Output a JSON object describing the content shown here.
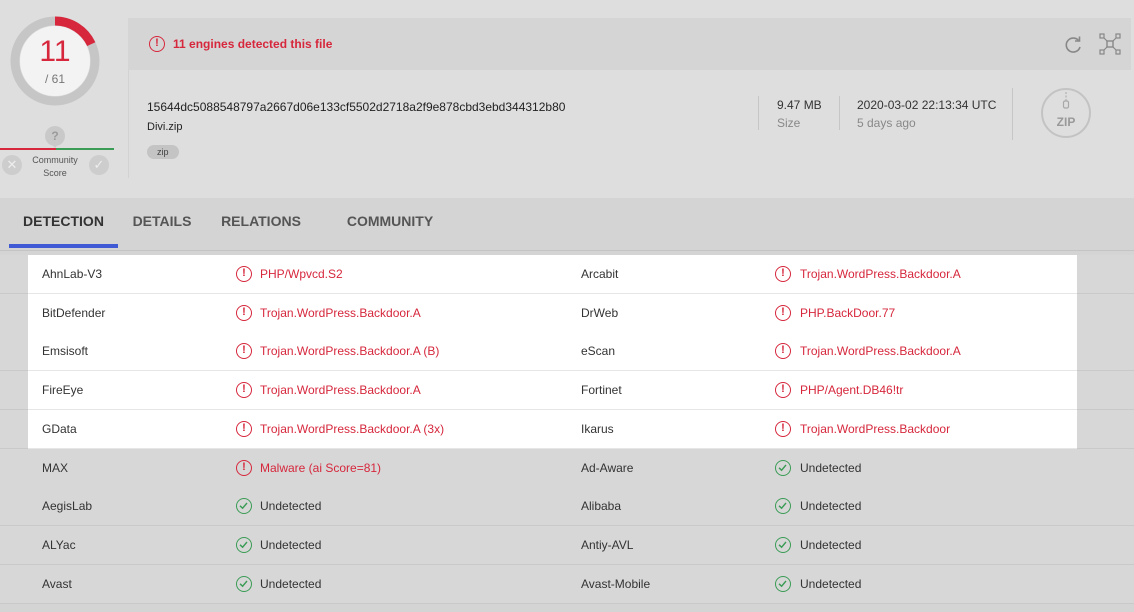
{
  "score": {
    "detected": "11",
    "total": "/ 61"
  },
  "community": {
    "label_line1": "Community",
    "label_line2": "Score",
    "question": "?",
    "neg": "✕",
    "pos": "✓"
  },
  "banner": {
    "text": "11 engines detected this file",
    "icon": "!"
  },
  "file": {
    "hash": "15644dc5088548797a2667d06e133cf5502d2718a2f9e878cbd3ebd344312b80",
    "name": "Divi.zip",
    "tag": "zip",
    "size_value": "9.47 MB",
    "size_label": "Size",
    "date_value": "2020-03-02 22:13:34 UTC",
    "date_label": "5 days ago",
    "type_icon_text": "ZIP"
  },
  "colors": {
    "danger": "#d6273c",
    "safe": "#3a9c55",
    "accent": "#3f5ad4"
  },
  "tabs": [
    {
      "label": "DETECTION",
      "active": true
    },
    {
      "label": "DETAILS",
      "active": false
    },
    {
      "label": "RELATIONS",
      "active": false
    },
    {
      "label": "COMMUNITY",
      "active": false
    }
  ],
  "results": [
    {
      "left": {
        "engine": "AhnLab-V3",
        "result": "PHP/Wpvcd.S2",
        "status": "detected"
      },
      "right": {
        "engine": "Arcabit",
        "result": "Trojan.WordPress.Backdoor.A",
        "status": "detected"
      }
    },
    {
      "left": {
        "engine": "BitDefender",
        "result": "Trojan.WordPress.Backdoor.A",
        "status": "detected"
      },
      "right": {
        "engine": "DrWeb",
        "result": "PHP.BackDoor.77",
        "status": "detected"
      }
    },
    {
      "left": {
        "engine": "Emsisoft",
        "result": "Trojan.WordPress.Backdoor.A (B)",
        "status": "detected"
      },
      "right": {
        "engine": "eScan",
        "result": "Trojan.WordPress.Backdoor.A",
        "status": "detected"
      }
    },
    {
      "left": {
        "engine": "FireEye",
        "result": "Trojan.WordPress.Backdoor.A",
        "status": "detected"
      },
      "right": {
        "engine": "Fortinet",
        "result": "PHP/Agent.DB46!tr",
        "status": "detected"
      }
    },
    {
      "left": {
        "engine": "GData",
        "result": "Trojan.WordPress.Backdoor.A (3x)",
        "status": "detected"
      },
      "right": {
        "engine": "Ikarus",
        "result": "Trojan.WordPress.Backdoor",
        "status": "detected"
      }
    },
    {
      "left": {
        "engine": "MAX",
        "result": "Malware (ai Score=81)",
        "status": "detected"
      },
      "right": {
        "engine": "Ad-Aware",
        "result": "Undetected",
        "status": "undetected"
      }
    },
    {
      "left": {
        "engine": "AegisLab",
        "result": "Undetected",
        "status": "undetected"
      },
      "right": {
        "engine": "Alibaba",
        "result": "Undetected",
        "status": "undetected"
      }
    },
    {
      "left": {
        "engine": "ALYac",
        "result": "Undetected",
        "status": "undetected"
      },
      "right": {
        "engine": "Antiy-AVL",
        "result": "Undetected",
        "status": "undetected"
      }
    },
    {
      "left": {
        "engine": "Avast",
        "result": "Undetected",
        "status": "undetected"
      },
      "right": {
        "engine": "Avast-Mobile",
        "result": "Undetected",
        "status": "undetected"
      }
    }
  ]
}
